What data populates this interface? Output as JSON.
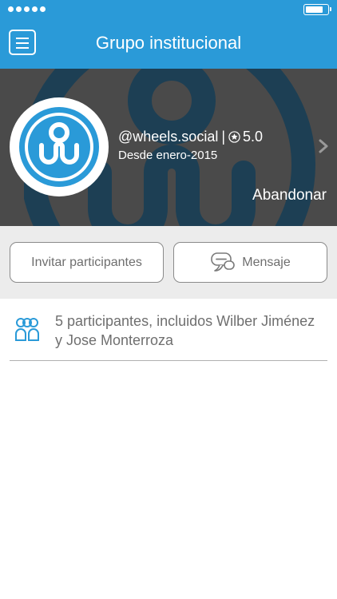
{
  "status_bar": {
    "signal_dots": 5,
    "battery_level": 0.7
  },
  "header": {
    "title": "Grupo institucional",
    "menu_icon": "hamburger-menu-icon"
  },
  "profile": {
    "handle": "@wheels.social",
    "separator": "|",
    "rating": "5.0",
    "since": "Desde enero-2015",
    "leave_label": "Abandonar"
  },
  "actions": {
    "invite_label": "Invitar participantes",
    "message_label": "Mensaje"
  },
  "participants": {
    "summary": "5 participantes, incluidos Wilber Jiménez y Jose Monterroza"
  },
  "colors": {
    "brand": "#2a9ad8",
    "header_bg": "#4a4a4a",
    "watermark": "#1d3f54",
    "actions_bg": "#ececec"
  }
}
